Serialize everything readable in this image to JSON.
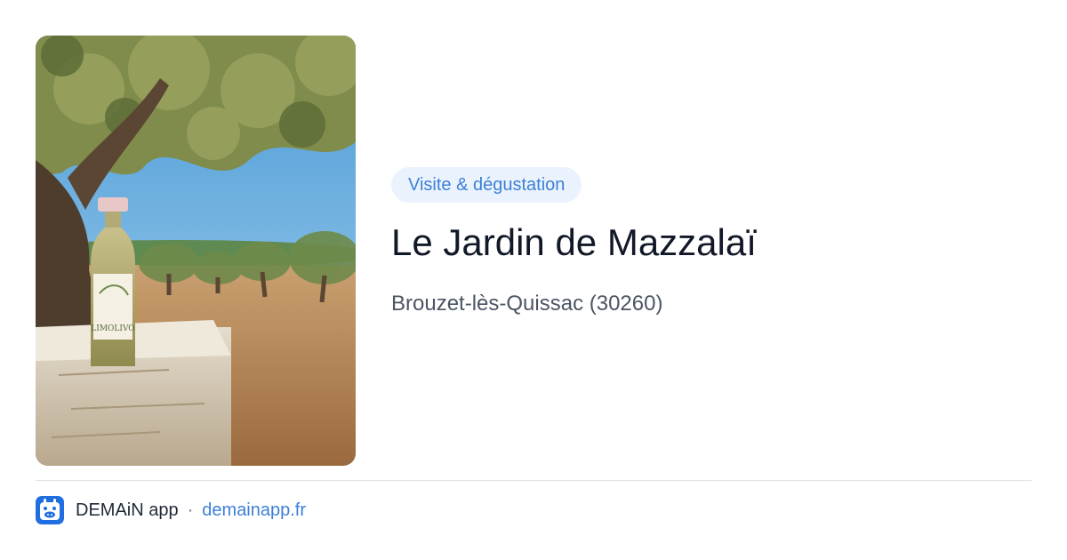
{
  "card": {
    "category": "Visite & dégustation",
    "title": "Le Jardin de Mazzalaï",
    "location": "Brouzet-lès-Quissac (30260)",
    "image": {
      "bottle_label": "LIMOLIVO"
    }
  },
  "footer": {
    "app_name": "DEMAiN app",
    "separator": "·",
    "app_url": "demainapp.fr",
    "logo_icon": "demain-app-icon"
  },
  "colors": {
    "accent": "#3d7fd6",
    "tag_background": "#eaf3fd",
    "title": "#111827",
    "secondary_text": "#4b5563",
    "divider": "#dde3ea"
  }
}
